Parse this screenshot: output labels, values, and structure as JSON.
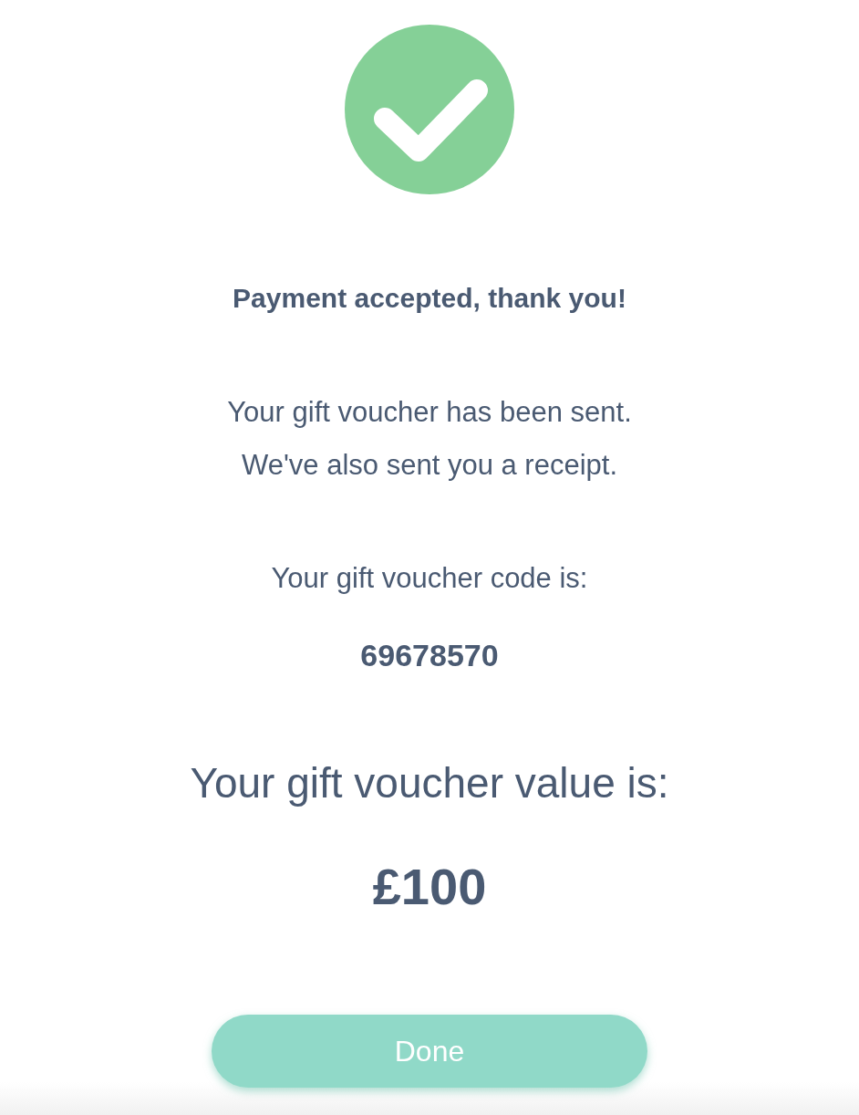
{
  "title": "Payment accepted, thank you!",
  "message_lines": [
    "Your gift voucher has been sent.",
    "We've also sent you a receipt."
  ],
  "code_label": "Your gift voucher code is:",
  "code": "69678570",
  "value_label": "Your gift voucher value is:",
  "value": "£100",
  "button": {
    "label": "Done"
  }
}
